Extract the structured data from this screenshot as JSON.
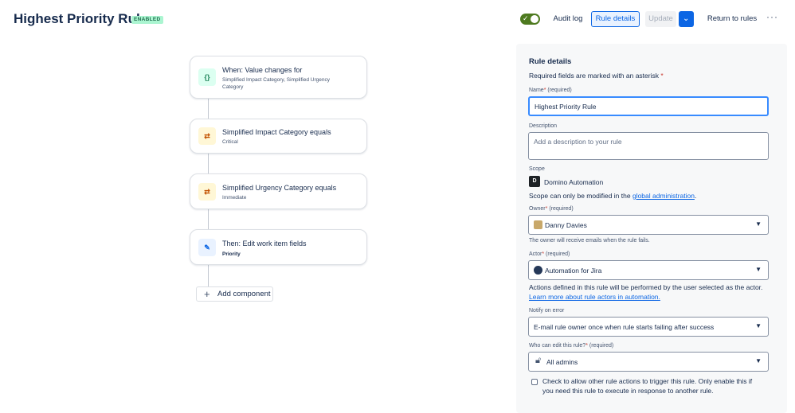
{
  "header": {
    "title": "Highest Priority Rule",
    "status_badge": "ENABLED",
    "audit_log": "Audit log",
    "rule_details": "Rule details",
    "update": "Update",
    "return_to_rules": "Return to rules",
    "more": "···"
  },
  "flow": {
    "nodes": [
      {
        "title": "When: Value changes for",
        "subtitle": "Simplified Impact Category, Simplified Urgency Category",
        "icon": "code-braces-icon",
        "glyph": "{}"
      },
      {
        "title": "Simplified Impact Category equals",
        "subtitle": "Critical",
        "icon": "branch-swap-icon",
        "glyph": "⇄"
      },
      {
        "title": "Simplified Urgency Category equals",
        "subtitle": "Immediate",
        "icon": "branch-swap-icon",
        "glyph": "⇄"
      },
      {
        "title": "Then: Edit work item fields",
        "subtitle": "Priority",
        "icon": "edit-icon",
        "glyph": "✎"
      }
    ],
    "add_component": "Add component"
  },
  "panel": {
    "heading": "Rule details",
    "required_note": "Required fields are marked with an asterisk",
    "name_label": "Name",
    "required_suffix": "(required)",
    "name_value": "Highest Priority Rule",
    "description_label": "Description",
    "description_placeholder": "Add a description to your rule",
    "scope_label": "Scope",
    "scope_value": "Domino Automation",
    "scope_note": "Scope can only be modified in the",
    "scope_link": "global administration",
    "owner_label": "Owner",
    "owner_value": "Danny Davies",
    "owner_help": "The owner will receive emails when the rule fails.",
    "actor_label": "Actor",
    "actor_value": "Automation for Jira",
    "actor_help": "Actions defined in this rule will be performed by the user selected as the actor.",
    "actor_link": "Learn more about rule actors in automation.",
    "notify_label": "Notify on error",
    "notify_value": "E-mail rule owner once when rule starts failing after success",
    "edit_label": "Who can edit this rule?",
    "edit_value": "All admins",
    "checkbox_line1": "Check to allow other rule actions to trigger this rule. Only enable this if",
    "checkbox_line2": "you need this rule to execute in response to another rule."
  },
  "colors": {
    "accent": "#0c66e4",
    "toggle_on": "#4e7a1f",
    "badge_bg": "#abf5d1",
    "trigger_icon_bg": "#dcfff1",
    "condition_icon_bg": "#fff7d6",
    "action_icon_bg": "#e9f2ff"
  }
}
